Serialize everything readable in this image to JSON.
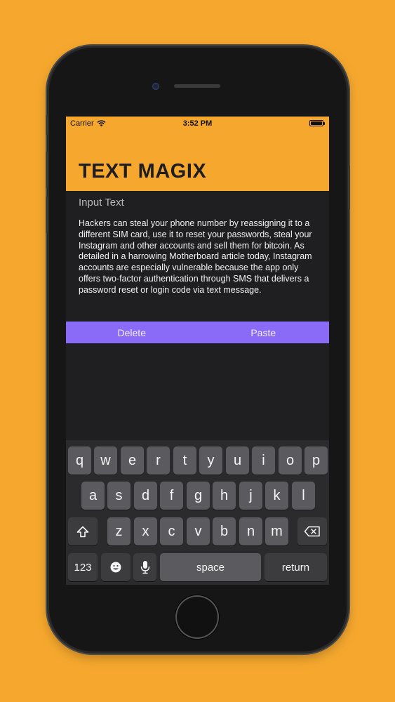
{
  "status_bar": {
    "carrier": "Carrier",
    "time": "3:52 PM"
  },
  "app": {
    "title": "TEXT MAGIX"
  },
  "editor": {
    "label": "Input Text",
    "text": "Hackers can steal your phone number by reassigning it to a different SIM card, use it to reset your passwords, steal your Instagram  and other accounts and sell them for bitcoin. As detailed in a harrowing Motherboard article today, Instagram accounts are especially vulnerable because the app only offers two-factor authentication through SMS that delivers a password reset or login code via text message."
  },
  "actions": {
    "delete_label": "Delete",
    "paste_label": "Paste"
  },
  "keyboard": {
    "row1": [
      "q",
      "w",
      "e",
      "r",
      "t",
      "y",
      "u",
      "i",
      "o",
      "p"
    ],
    "row2": [
      "a",
      "s",
      "d",
      "f",
      "g",
      "h",
      "j",
      "k",
      "l"
    ],
    "row3": [
      "z",
      "x",
      "c",
      "v",
      "b",
      "n",
      "m"
    ],
    "numbers_label": "123",
    "space_label": "space",
    "return_label": "return"
  },
  "colors": {
    "background": "#F6A82E",
    "accent": "#8A6BF7",
    "screen": "#1F1F21"
  }
}
